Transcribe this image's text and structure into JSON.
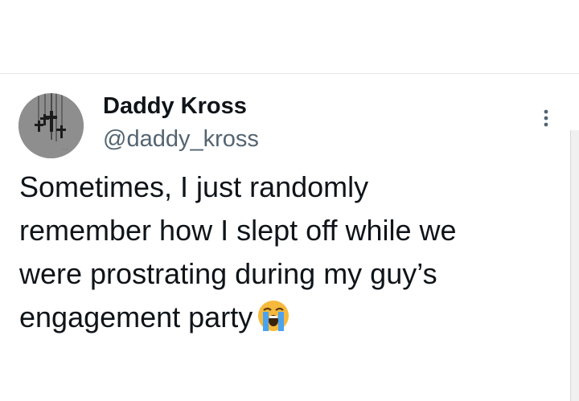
{
  "tweet": {
    "author": {
      "display_name": "Daddy Kross",
      "handle": "@daddy_kross",
      "avatar_icon": "crosses-avatar"
    },
    "text_lines": [
      "Sometimes, I just randomly",
      "remember how I slept off while we",
      "were prostrating during my guy’s",
      "engagement party"
    ],
    "emoji": "loudly-crying-face-icon",
    "more_icon": "more-vertical-icon"
  }
}
